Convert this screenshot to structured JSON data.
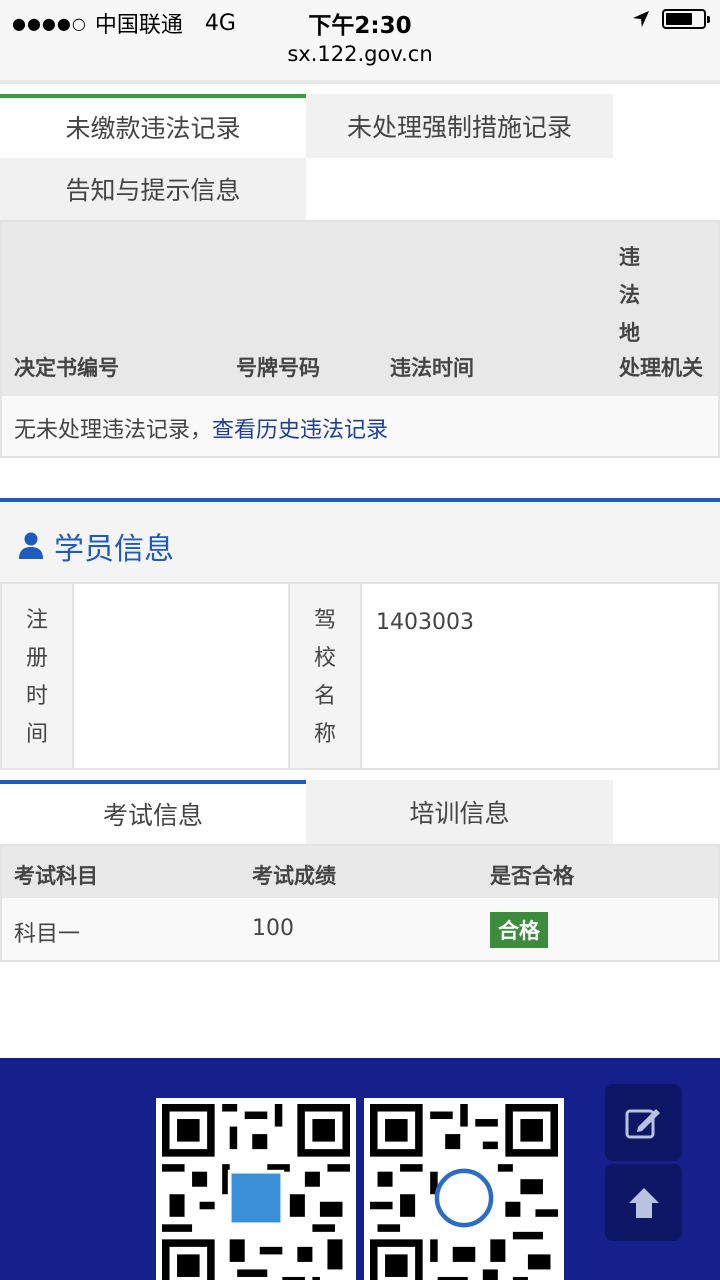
{
  "status_bar": {
    "signal": "●●●●○",
    "carrier": "中国联通",
    "network": "4G",
    "time": "下午2:30"
  },
  "url": "sx.122.gov.cn",
  "violation_tabs": [
    {
      "label": "未缴款违法记录",
      "active": true
    },
    {
      "label": "未处理强制措施记录",
      "active": false
    },
    {
      "label": "告知与提示信息",
      "active": false
    }
  ],
  "violation_table": {
    "headers": [
      "决定书编号",
      "号牌号码",
      "违法时间"
    ],
    "vertical_header": [
      "违",
      "法",
      "地"
    ],
    "last_header": "处理机关",
    "empty_text": "无未处理违法记录，",
    "history_link": "查看历史违法记录"
  },
  "student": {
    "title": "学员信息",
    "reg_time_label": "注册时间",
    "reg_time_chars": [
      "注",
      "册",
      "时",
      "间"
    ],
    "reg_time_value": "",
    "school_label_chars": [
      "驾",
      "校",
      "名",
      "称"
    ],
    "school_value": "1403003"
  },
  "exam_tabs": [
    {
      "label": "考试信息",
      "active": true
    },
    {
      "label": "培训信息",
      "active": false
    }
  ],
  "exam_table": {
    "headers": [
      "考试科目",
      "考试成绩",
      "是否合格"
    ],
    "rows": [
      {
        "subject": "科目一",
        "score": "100",
        "passed": "合格"
      }
    ]
  },
  "colors": {
    "accent_blue": "#1f5bbf",
    "accent_green": "#3a9b4a",
    "footer_bg": "#15208c",
    "pass_badge": "#3d8b3d"
  }
}
